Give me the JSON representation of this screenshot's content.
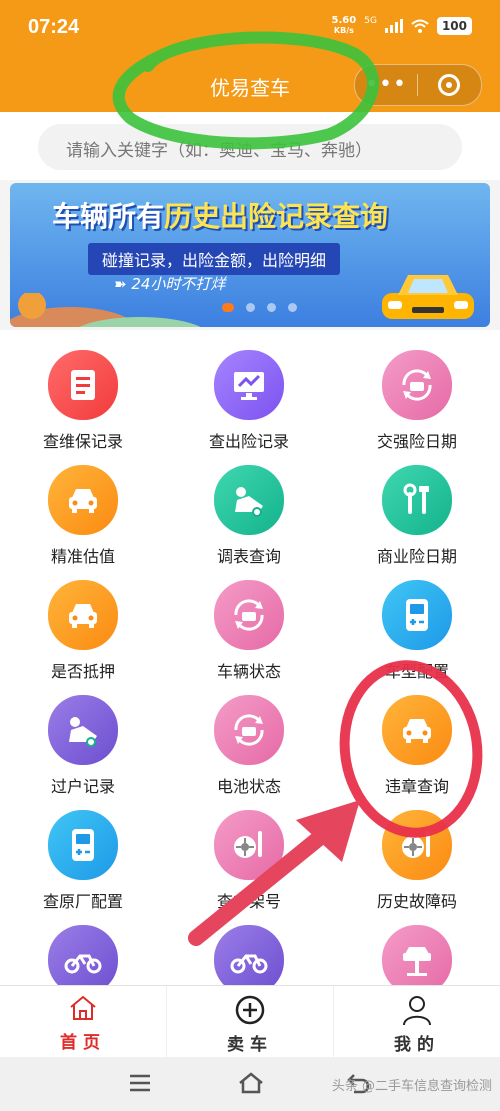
{
  "status_bar": {
    "time": "07:24",
    "net_speed_value": "5.60",
    "net_speed_unit": "KB/s",
    "network": "5G",
    "battery": "100"
  },
  "header": {
    "title": "优易查车",
    "more_icon": "more-dots-icon",
    "close_icon": "target-close-icon",
    "bg_color": "#f49a16"
  },
  "search": {
    "placeholder": "请输入关键字（如：奥迪、宝马、奔驰）"
  },
  "banner": {
    "title_part1": "车辆所有",
    "title_part2": "历史出险记录查询",
    "subtitle": "碰撞记录，出险金额，出险明细",
    "tagline": "24小时不打烊",
    "pages": 4,
    "active_page": 1
  },
  "services": [
    {
      "label": "查维保记录",
      "icon": "document-icon",
      "color": "red"
    },
    {
      "label": "查出险记录",
      "icon": "monitor-chart-icon",
      "color": "purple"
    },
    {
      "label": "交强险日期",
      "icon": "car-refresh-icon",
      "color": "pink"
    },
    {
      "label": "精准估值",
      "icon": "car-front-icon",
      "color": "orange"
    },
    {
      "label": "调表查询",
      "icon": "mechanic-icon",
      "color": "teal"
    },
    {
      "label": "商业险日期",
      "icon": "tools-icon",
      "color": "teal"
    },
    {
      "label": "是否抵押",
      "icon": "car-front-icon",
      "color": "orange"
    },
    {
      "label": "车辆状态",
      "icon": "car-refresh-icon",
      "color": "pink"
    },
    {
      "label": "车型配置",
      "icon": "battery-device-icon",
      "color": "blue"
    },
    {
      "label": "过户记录",
      "icon": "mechanic-icon",
      "color": "violet"
    },
    {
      "label": "电池状态",
      "icon": "car-refresh-icon",
      "color": "pink"
    },
    {
      "label": "违章查询",
      "icon": "car-front-icon",
      "color": "orange"
    },
    {
      "label": "查原厂配置",
      "icon": "battery-device-icon",
      "color": "blue"
    },
    {
      "label": "查车架号",
      "icon": "wheel-wrench-icon",
      "color": "pink"
    },
    {
      "label": "历史故障码",
      "icon": "wheel-wrench-icon",
      "color": "orange"
    },
    {
      "label": "",
      "icon": "motorcycle-icon",
      "color": "violet"
    },
    {
      "label": "",
      "icon": "motorcycle-icon",
      "color": "violet"
    },
    {
      "label": "",
      "icon": "car-lift-icon",
      "color": "pink"
    }
  ],
  "tabbar": {
    "home": "首页",
    "sell": "卖车",
    "mine": "我的",
    "active_color": "#e02b2b"
  },
  "watermark": "头条 @二手车信息查询检测"
}
